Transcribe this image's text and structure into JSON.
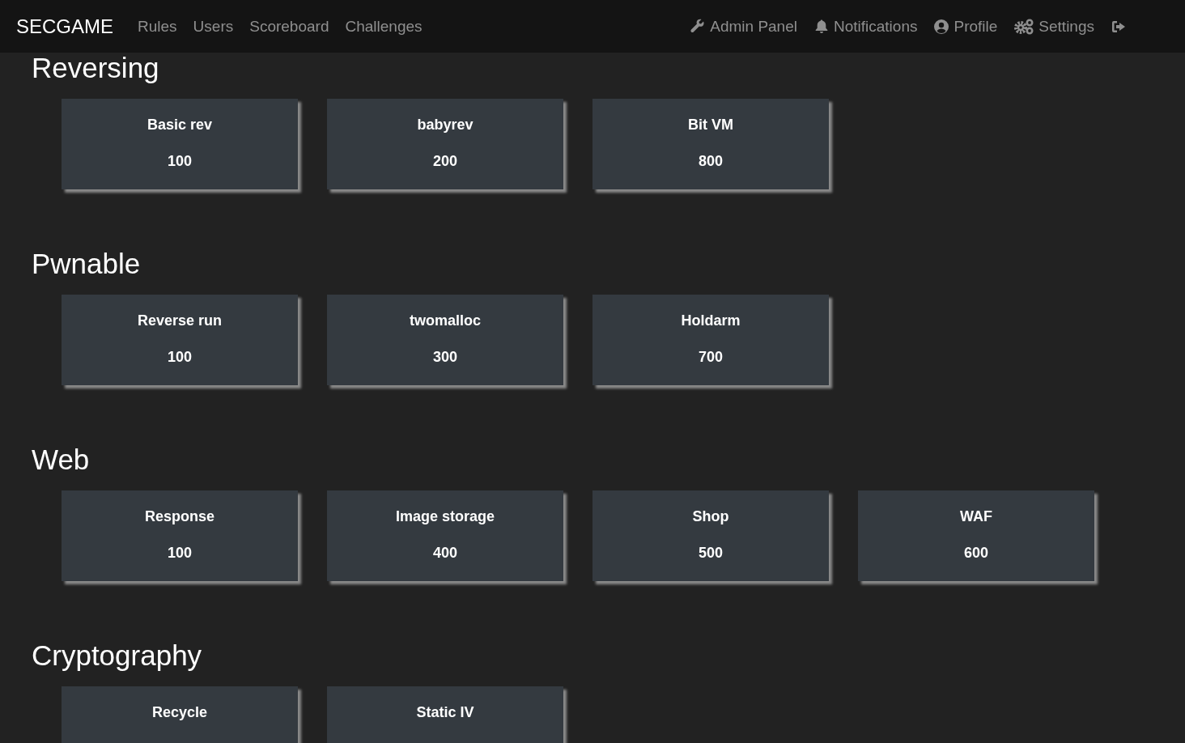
{
  "navbar": {
    "brand": "SECGAME",
    "left_links": [
      "Rules",
      "Users",
      "Scoreboard",
      "Challenges"
    ],
    "right_links": [
      "Admin Panel",
      "Notifications",
      "Profile",
      "Settings"
    ]
  },
  "categories": [
    {
      "title": "Reversing",
      "challenges": [
        {
          "name": "Basic rev",
          "points": "100"
        },
        {
          "name": "babyrev",
          "points": "200"
        },
        {
          "name": "Bit VM",
          "points": "800"
        }
      ]
    },
    {
      "title": "Pwnable",
      "challenges": [
        {
          "name": "Reverse run",
          "points": "100"
        },
        {
          "name": "twomalloc",
          "points": "300"
        },
        {
          "name": "Holdarm",
          "points": "700"
        }
      ]
    },
    {
      "title": "Web",
      "challenges": [
        {
          "name": "Response",
          "points": "100"
        },
        {
          "name": "Image storage",
          "points": "400"
        },
        {
          "name": "Shop",
          "points": "500"
        },
        {
          "name": "WAF",
          "points": "600"
        }
      ]
    },
    {
      "title": "Cryptography",
      "challenges": [
        {
          "name": "Recycle"
        },
        {
          "name": "Static IV"
        }
      ]
    }
  ]
}
